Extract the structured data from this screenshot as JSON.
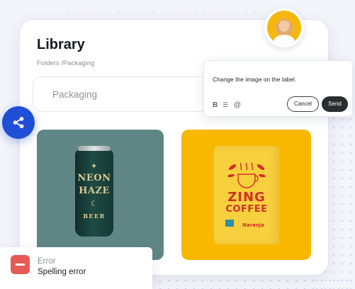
{
  "library": {
    "title": "Library",
    "breadcrumb": "Folders /Packaging",
    "search_value": "Packaging"
  },
  "images": [
    {
      "name": "neon-haze-beer-can",
      "background": "#5f8785",
      "text": [
        "NEON",
        "HAZE",
        "BEER"
      ]
    },
    {
      "name": "zing-coffee-bag",
      "background": "#f8b800",
      "text": [
        "ZING",
        "COFFEE",
        "Naranja"
      ]
    }
  ],
  "comment": {
    "text": "Change the image on the label.",
    "format_icons": [
      "bold-icon",
      "list-icon",
      "mention-icon"
    ],
    "format_glyphs": [
      "B",
      "☰",
      "@"
    ],
    "cancel_label": "Cancel",
    "send_label": "Send"
  },
  "toast": {
    "title": "Error",
    "message": "Spelling error",
    "color": "#e85a56"
  },
  "share": {
    "icon": "share-icon",
    "color": "#1f4fd6"
  },
  "avatar": {
    "icon": "user-avatar"
  }
}
